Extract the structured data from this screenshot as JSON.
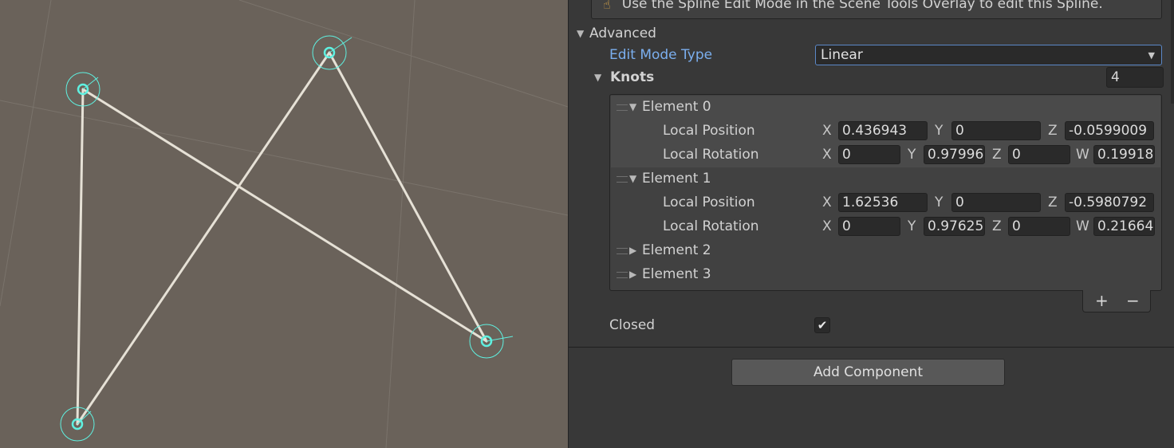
{
  "inspector": {
    "help_text": "Use the Spline Edit Mode in the Scene Tools Overlay to edit this Spline.",
    "advanced_label": "Advanced",
    "edit_mode_label": "Edit Mode Type",
    "edit_mode_value": "Linear",
    "knots_label": "Knots",
    "knots_count": "4",
    "elements": [
      {
        "label": "Element 0",
        "expanded": true,
        "pos_label": "Local Position",
        "rot_label": "Local Rotation",
        "pos": {
          "x": "0.436943",
          "y": "0",
          "z": "-0.0599009"
        },
        "rot": {
          "x": "0",
          "y": "0.97996",
          "z": "0",
          "w": "0.19918"
        }
      },
      {
        "label": "Element 1",
        "expanded": true,
        "pos_label": "Local Position",
        "rot_label": "Local Rotation",
        "pos": {
          "x": "1.62536",
          "y": "0",
          "z": "-0.5980792"
        },
        "rot": {
          "x": "0",
          "y": "0.97625",
          "z": "0",
          "w": "0.21664"
        }
      },
      {
        "label": "Element 2",
        "expanded": false
      },
      {
        "label": "Element 3",
        "expanded": false
      }
    ],
    "axis": {
      "x": "X",
      "y": "Y",
      "z": "Z",
      "w": "W"
    },
    "plus": "+",
    "minus": "−",
    "closed_label": "Closed",
    "closed_checked": "✔",
    "add_component": "Add Component"
  },
  "icons": {
    "warning": "info-icon",
    "fold_open": "▼",
    "fold_closed": "▶",
    "dropdown": "▼"
  },
  "colors": {
    "scene_bg": "#6a625a",
    "spline": "#e6e1d6",
    "knot": "#5ff0e0",
    "accent_label": "#7bafef",
    "dropdown_border": "#5b88c8"
  }
}
